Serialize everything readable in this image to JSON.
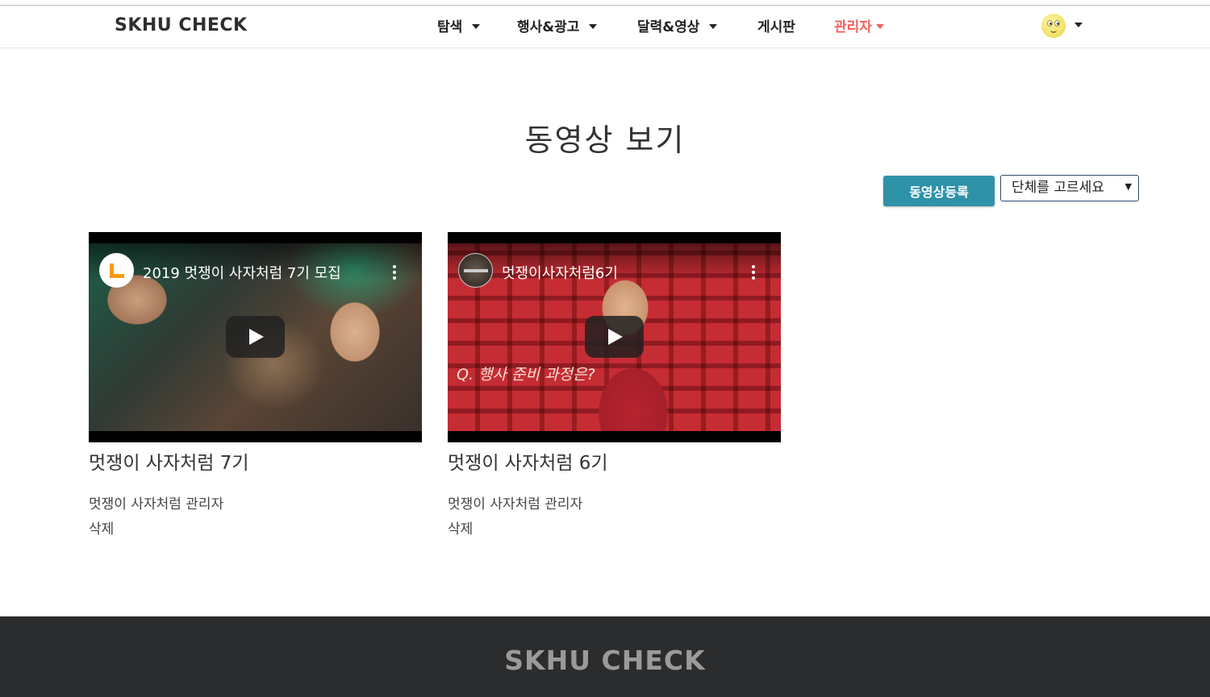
{
  "header": {
    "brand": "SKHU CHECK",
    "nav": [
      {
        "label": "탐색",
        "dropdown": true
      },
      {
        "label": "행사&광고",
        "dropdown": true
      },
      {
        "label": "달력&영상",
        "dropdown": true
      },
      {
        "label": "게시판",
        "dropdown": false
      },
      {
        "label": "관리자",
        "dropdown": true
      }
    ],
    "avatar_icon": "smiley-face-icon"
  },
  "main": {
    "title": "동영상 보기",
    "register_button": "동영상등록",
    "group_select": {
      "selected": "단체를 고르세요"
    }
  },
  "videos": [
    {
      "video_title": "2019 멋쟁이 사자처럼 7기 모집",
      "caption": "",
      "title": "멋쟁이 사자처럼 7기",
      "org": "멋쟁이 사자처럼 관리자",
      "delete_label": "삭제"
    },
    {
      "video_title": "멋쟁이사자처럼6기",
      "caption": "Q. 행사 준비 과정은?",
      "title": "멋쟁이 사자처럼 6기",
      "org": "멋쟁이 사자처럼 관리자",
      "delete_label": "삭제"
    }
  ],
  "footer": {
    "brand": "SKHU CHECK"
  },
  "colors": {
    "accent": "#2e92a9",
    "admin": "#f25f5c",
    "footer_bg": "#2b2c2d"
  }
}
